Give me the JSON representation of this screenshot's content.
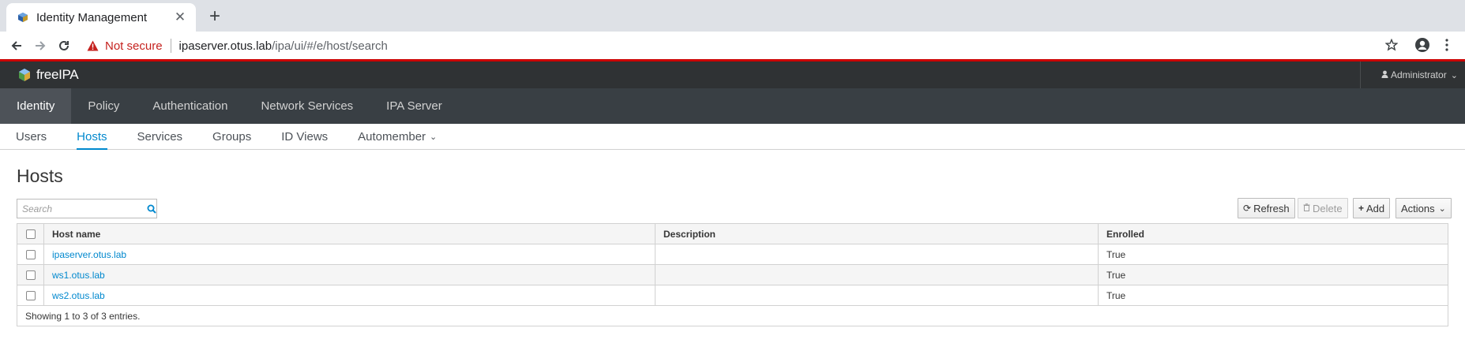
{
  "browser": {
    "tab_title": "Identity Management",
    "security_label": "Not secure",
    "url_host": "ipaserver.otus.lab",
    "url_path": "/ipa/ui/#/e/host/search"
  },
  "app": {
    "brand": "freeIPA",
    "user_menu": "Administrator",
    "primary_nav": [
      {
        "label": "Identity",
        "active": true
      },
      {
        "label": "Policy"
      },
      {
        "label": "Authentication"
      },
      {
        "label": "Network Services"
      },
      {
        "label": "IPA Server"
      }
    ],
    "secondary_nav": [
      {
        "label": "Users"
      },
      {
        "label": "Hosts",
        "active": true
      },
      {
        "label": "Services"
      },
      {
        "label": "Groups"
      },
      {
        "label": "ID Views"
      },
      {
        "label": "Automember"
      }
    ]
  },
  "page": {
    "title": "Hosts",
    "search_placeholder": "Search",
    "buttons": {
      "refresh": "Refresh",
      "delete": "Delete",
      "add": "Add",
      "actions": "Actions"
    },
    "table": {
      "columns": [
        "Host name",
        "Description",
        "Enrolled"
      ],
      "rows": [
        {
          "host": "ipaserver.otus.lab",
          "description": "",
          "enrolled": "True"
        },
        {
          "host": "ws1.otus.lab",
          "description": "",
          "enrolled": "True"
        },
        {
          "host": "ws2.otus.lab",
          "description": "",
          "enrolled": "True"
        }
      ],
      "footer": "Showing 1 to 3 of 3 entries."
    }
  },
  "colors": {
    "accent": "#0088ce",
    "masthead": "#2f3234",
    "primary_nav": "#393f44",
    "security_warning": "#c5221f"
  }
}
